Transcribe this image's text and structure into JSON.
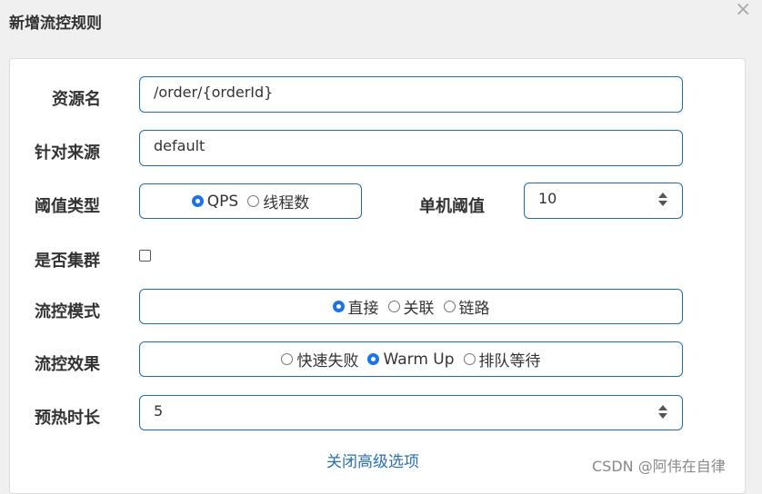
{
  "dialog": {
    "title": "新增流控规则",
    "close_glyph": "×"
  },
  "form": {
    "resource_name": {
      "label": "资源名",
      "value": "/order/{orderId}"
    },
    "limit_app": {
      "label": "针对来源",
      "value": "default"
    },
    "threshold_type": {
      "label": "阈值类型",
      "options": [
        {
          "label": "QPS",
          "selected": true
        },
        {
          "label": "线程数",
          "selected": false
        }
      ]
    },
    "single_threshold": {
      "label": "单机阈值",
      "value": "10"
    },
    "cluster": {
      "label": "是否集群",
      "checked": false
    },
    "flow_mode": {
      "label": "流控模式",
      "options": [
        {
          "label": "直接",
          "selected": true
        },
        {
          "label": "关联",
          "selected": false
        },
        {
          "label": "链路",
          "selected": false
        }
      ]
    },
    "flow_effect": {
      "label": "流控效果",
      "options": [
        {
          "label": "快速失败",
          "selected": false
        },
        {
          "label": "Warm Up",
          "selected": true
        },
        {
          "label": "排队等待",
          "selected": false
        }
      ]
    },
    "warmup_duration": {
      "label": "预热时长",
      "value": "5"
    }
  },
  "advanced_toggle": "关闭高级选项",
  "watermark": "CSDN @阿伟在自律",
  "colors": {
    "accent": "#1a73e8",
    "border": "#1f6da6",
    "link": "#2a6fb0"
  }
}
